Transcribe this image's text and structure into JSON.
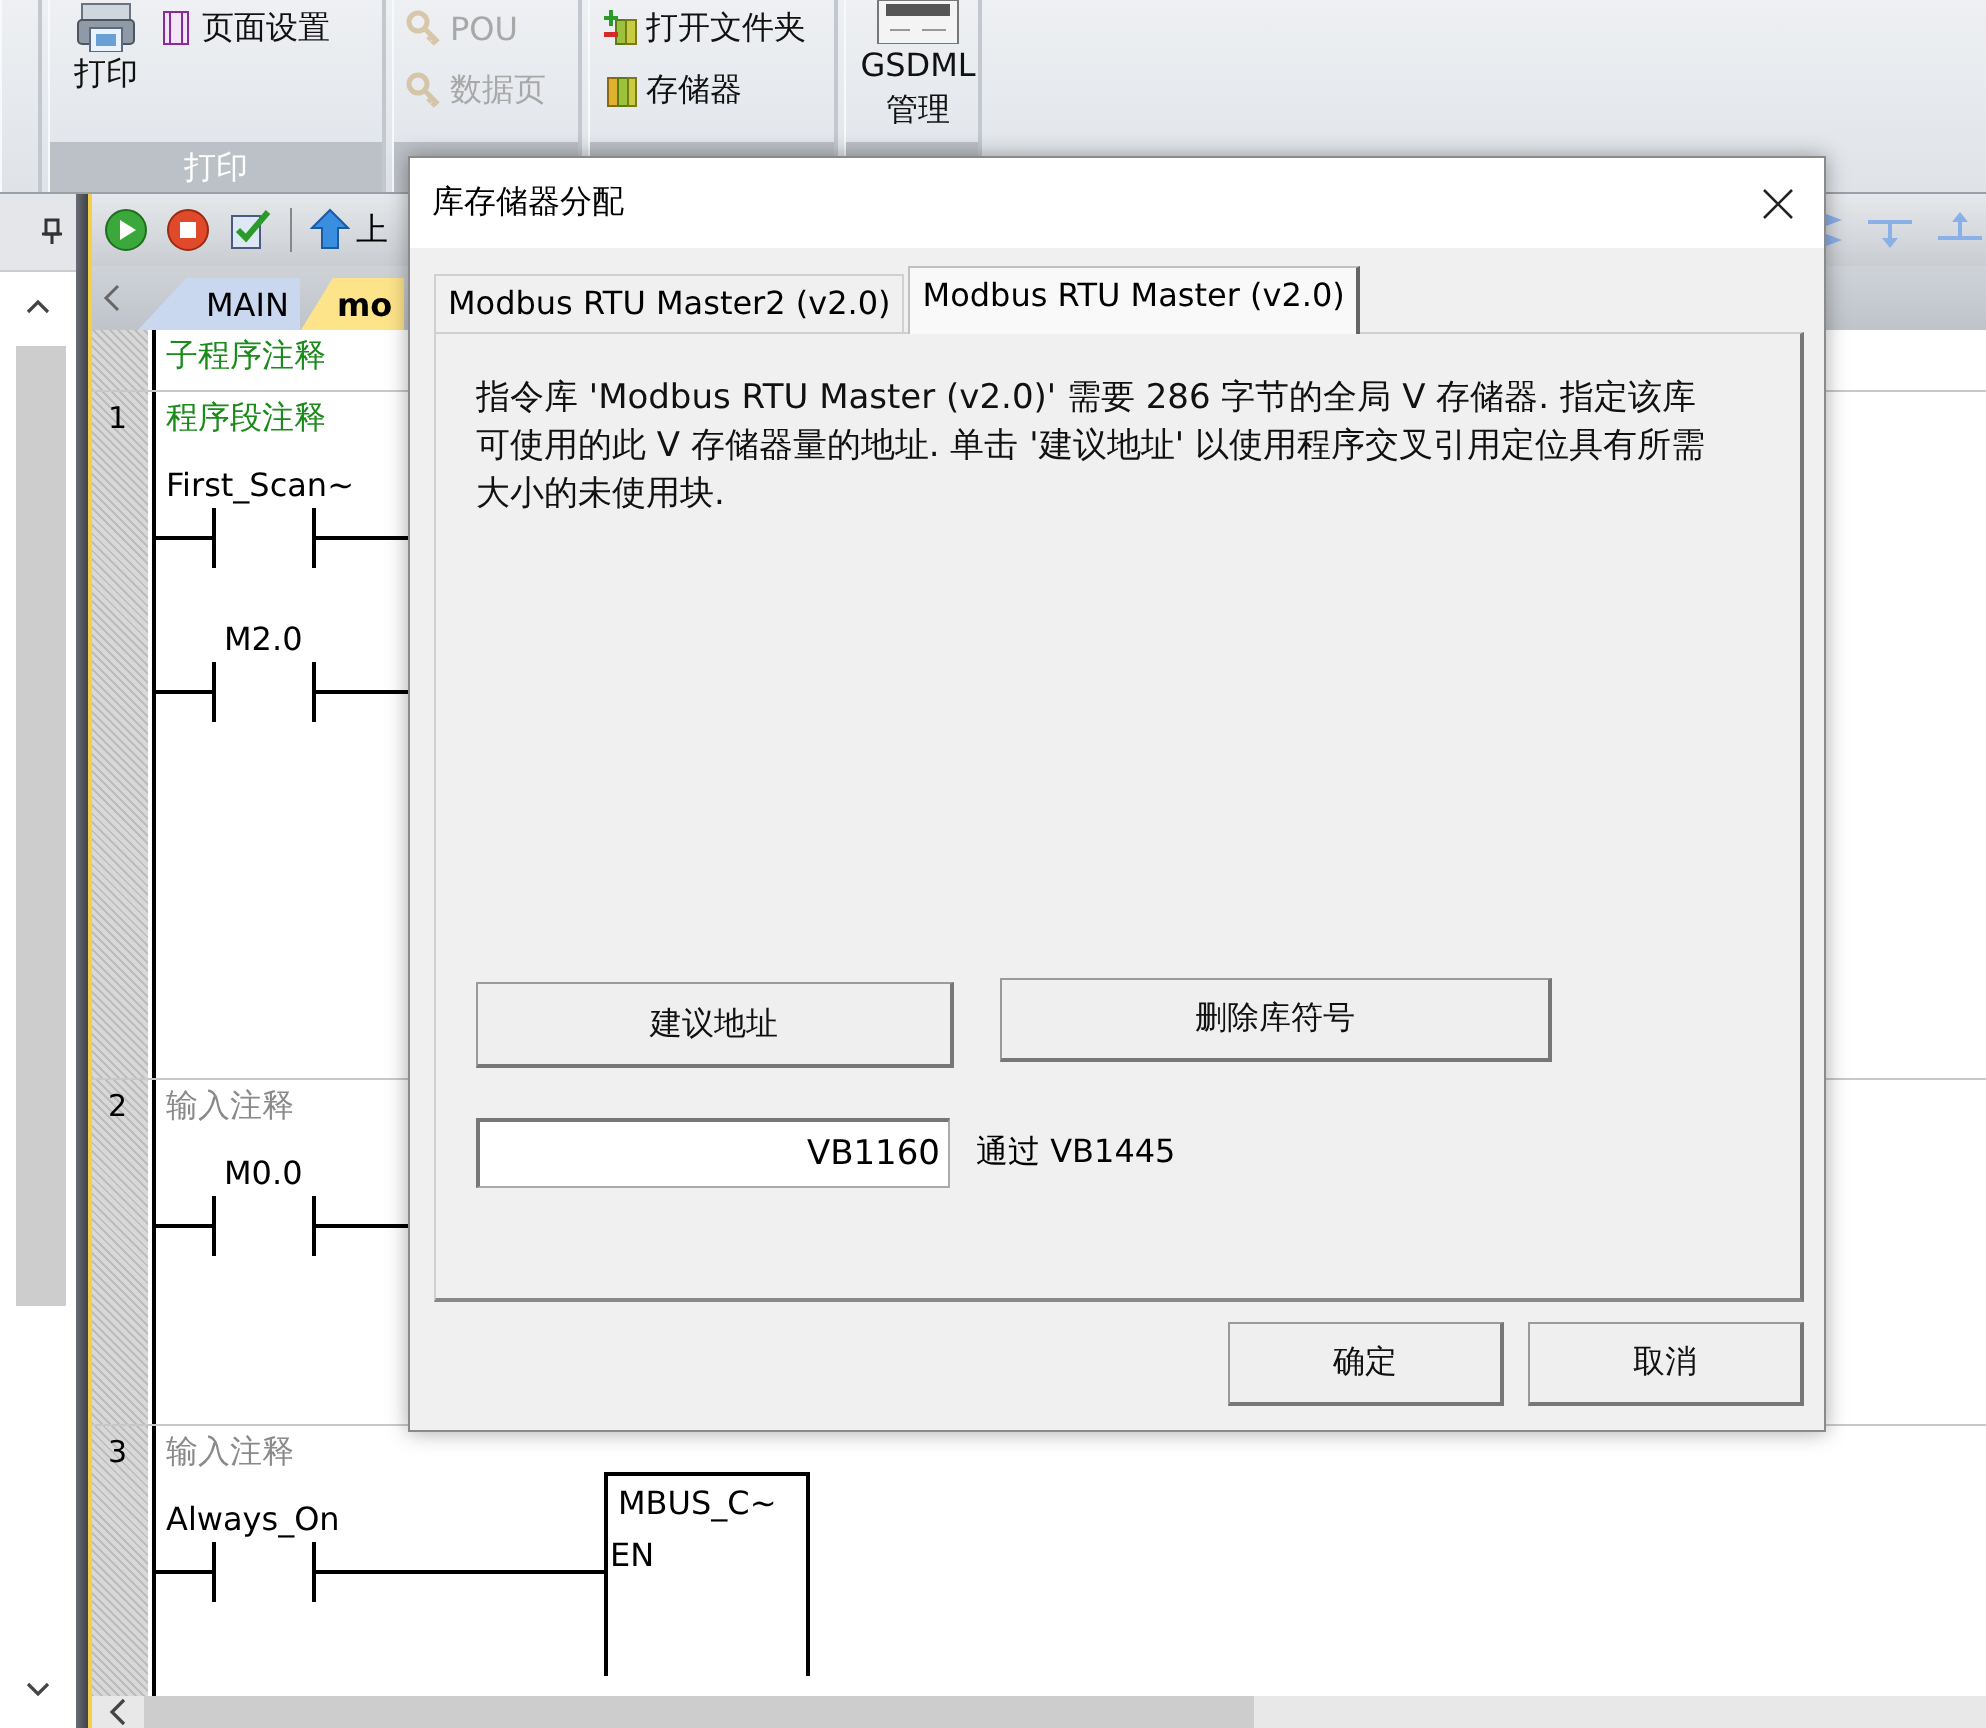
{
  "ribbon": {
    "groups": [
      {
        "label": "打印",
        "items": [
          {
            "label": "打印",
            "kind": "large",
            "disabled": false
          },
          {
            "label": "页面设置",
            "kind": "small",
            "disabled": false
          }
        ]
      },
      {
        "items": [
          {
            "label": "POU",
            "kind": "small",
            "disabled": true
          },
          {
            "label": "数据页",
            "kind": "small",
            "disabled": true
          }
        ]
      },
      {
        "items": [
          {
            "label": "打开文件夹",
            "kind": "small",
            "disabled": false
          },
          {
            "label": "存储器",
            "kind": "small",
            "disabled": false
          }
        ]
      },
      {
        "items": [
          {
            "label": "GSDML 管理",
            "kind": "large",
            "disabled": false
          }
        ]
      }
    ]
  },
  "editor": {
    "toolbar": [
      {
        "kind": "run"
      },
      {
        "kind": "stop"
      },
      {
        "kind": "check"
      },
      {
        "kind": "upload",
        "label": "上"
      }
    ],
    "tabs": [
      {
        "label": "MAIN",
        "selected": false
      },
      {
        "label": "mo",
        "selected": true
      }
    ],
    "subroutine_comment": "子程序注释",
    "networks": [
      {
        "number": "1",
        "comment": "程序段注释",
        "rungs": [
          {
            "contact": "First_Scan~"
          },
          {
            "contact": "M2.0"
          }
        ]
      },
      {
        "number": "2",
        "placeholder": "输入注释",
        "rungs": [
          {
            "contact": "M0.0"
          }
        ]
      },
      {
        "number": "3",
        "placeholder": "输入注释",
        "rungs": [
          {
            "contact": "Always_On",
            "box": {
              "title": "MBUS_C~",
              "pin": "EN"
            }
          }
        ]
      }
    ]
  },
  "dialog": {
    "title": "库存储器分配",
    "tabs": [
      {
        "label": "Modbus RTU Master2 (v2.0)",
        "selected": false
      },
      {
        "label": "Modbus RTU Master (v2.0)",
        "selected": true
      }
    ],
    "description": "指令库 'Modbus RTU Master (v2.0)' 需要 286 字节的全局 V 存储器. 指定该库可使用的此 V 存储器量的地址. 单击 '建议地址' 以使用程序交叉引用定位具有所需大小的未使用块.",
    "actions": [
      "建议地址",
      "删除库符号"
    ],
    "address": {
      "value": "VB1160"
    },
    "range_label": "通过 VB1445",
    "buttons": [
      "确定",
      "取消"
    ]
  }
}
